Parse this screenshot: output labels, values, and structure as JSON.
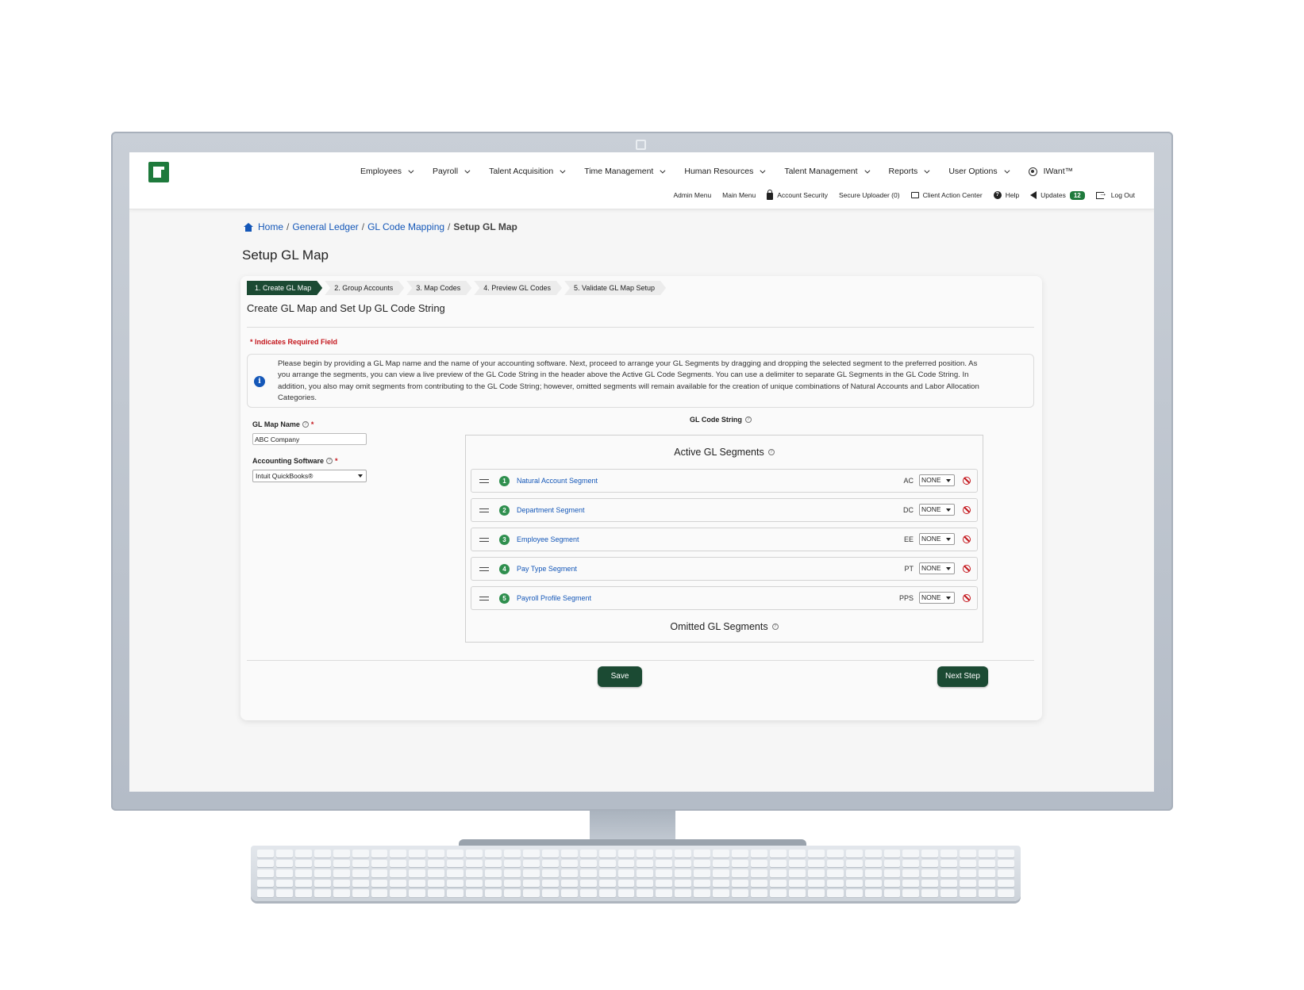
{
  "nav": {
    "main_items": [
      {
        "label": "Employees"
      },
      {
        "label": "Payroll"
      },
      {
        "label": "Talent Acquisition"
      },
      {
        "label": "Time Management"
      },
      {
        "label": "Human Resources"
      },
      {
        "label": "Talent Management"
      },
      {
        "label": "Reports"
      },
      {
        "label": "User Options"
      },
      {
        "label": "IWant™"
      }
    ],
    "sub_items": {
      "admin_menu": "Admin Menu",
      "main_menu": "Main Menu",
      "account_security": "Account Security",
      "secure_uploader": "Secure Uploader (0)",
      "client_action_center": "Client Action Center",
      "help": "Help",
      "updates": "Updates",
      "updates_count": "12",
      "log_out": "Log Out"
    }
  },
  "breadcrumb": {
    "home": "Home",
    "general_ledger": "General Ledger",
    "gl_code_mapping": "GL Code Mapping",
    "current": "Setup GL Map"
  },
  "page_title": "Setup GL Map",
  "steps": [
    {
      "label": "1. Create GL Map",
      "active": true
    },
    {
      "label": "2. Group Accounts",
      "active": false
    },
    {
      "label": "3. Map Codes",
      "active": false
    },
    {
      "label": "4. Preview GL Codes",
      "active": false
    },
    {
      "label": "5. Validate GL Map Setup",
      "active": false
    }
  ],
  "card_title": "Create GL Map and Set Up GL Code String",
  "required_note": "* Indicates Required Field",
  "info_text": "Please begin by providing a GL Map name and the name of your accounting software. Next, proceed to arrange your GL Segments by dragging and dropping the selected segment to the preferred position. As you arrange the segments, you can view a live preview of the GL Code String in the header above the Active GL Code Segments. You can use a delimiter to separate GL Segments in the GL Code String. In addition, you also may omit segments from contributing to the GL Code String; however, omitted segments will remain available for the creation of unique combinations of Natural Accounts and Labor Allocation Categories.",
  "form": {
    "map_name_label": "GL Map Name",
    "map_name_value": "ABC Company",
    "software_label": "Accounting Software",
    "software_value": "Intuit QuickBooks®",
    "required_star": "*"
  },
  "gl_code_string_label": "GL Code String",
  "active_heading": "Active GL Segments",
  "omitted_heading": "Omitted GL Segments",
  "segments": [
    {
      "num": "1",
      "name": "Natural Account Segment",
      "code": "AC",
      "delimiter": "NONE"
    },
    {
      "num": "2",
      "name": "Department Segment",
      "code": "DC",
      "delimiter": "NONE"
    },
    {
      "num": "3",
      "name": "Employee Segment",
      "code": "EE",
      "delimiter": "NONE"
    },
    {
      "num": "4",
      "name": "Pay Type Segment",
      "code": "PT",
      "delimiter": "NONE"
    },
    {
      "num": "5",
      "name": "Payroll Profile Segment",
      "code": "PPS",
      "delimiter": "NONE"
    }
  ],
  "buttons": {
    "save": "Save",
    "next_step": "Next Step"
  },
  "colors": {
    "brand_green": "#1e7a3c",
    "button_dark_green": "#1b4a33",
    "link_blue": "#1457b8",
    "required_red": "#c4161c"
  }
}
